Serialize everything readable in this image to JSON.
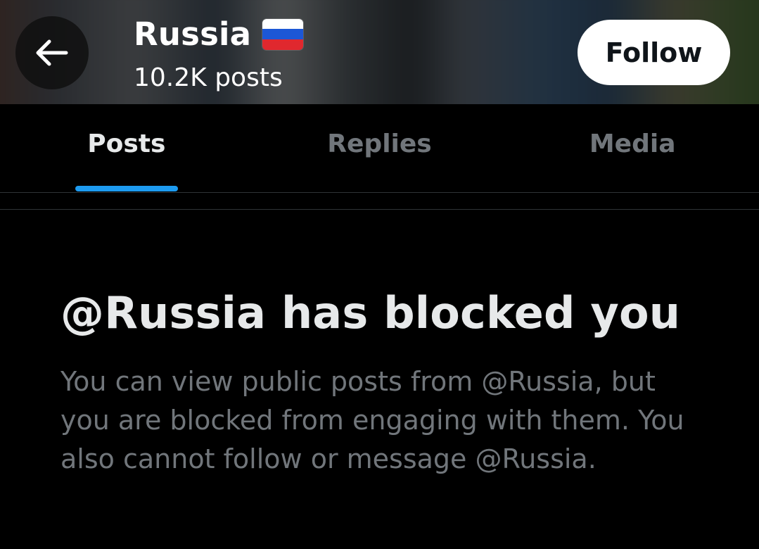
{
  "header": {
    "profile_name": "Russia",
    "flag_icon": "russia-flag-icon",
    "flag_colors": [
      "#ffffff",
      "#1c57d6",
      "#e0282e"
    ],
    "post_count": "10.2K posts",
    "back_icon": "arrow-left-icon",
    "follow_label": "Follow"
  },
  "tabs": [
    {
      "label": "Posts",
      "active": true
    },
    {
      "label": "Replies",
      "active": false
    },
    {
      "label": "Media",
      "active": false
    }
  ],
  "blocked": {
    "title": "@Russia has blocked you",
    "body": "You can view public posts from @Russia, but you are blocked from engaging with them. You also cannot follow or message @Russia."
  },
  "colors": {
    "accent": "#1d9bf0",
    "background": "#000000",
    "primary_text": "#e7e9ea",
    "secondary_text": "#71767b",
    "divider": "#2f3336"
  }
}
